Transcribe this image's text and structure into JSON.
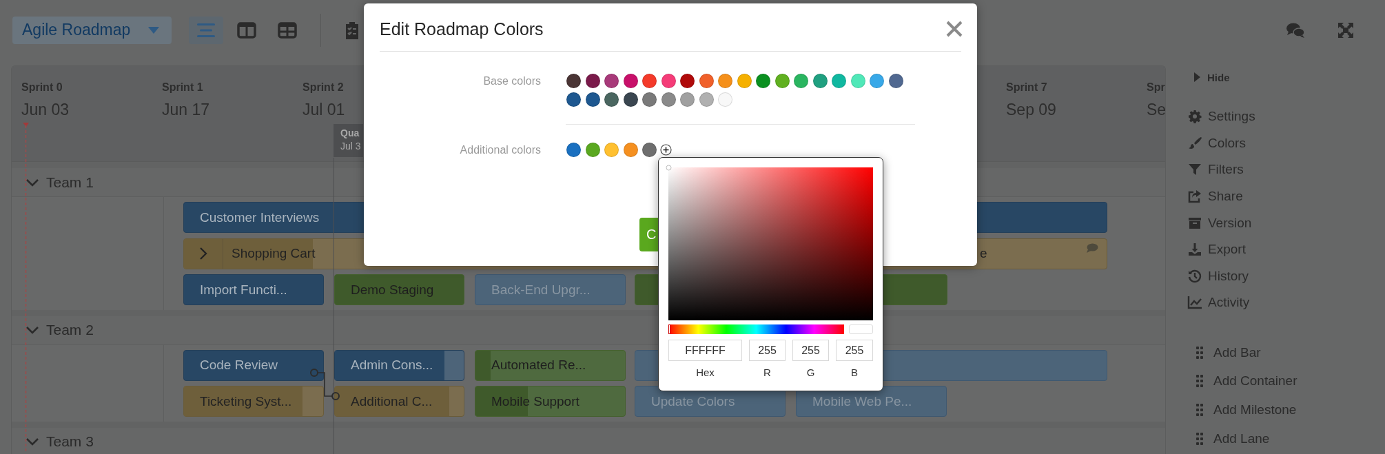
{
  "toolbar": {
    "roadmap_name": "Agile Roadmap",
    "views": [
      {
        "kind": "list",
        "selected": true
      },
      {
        "kind": "split",
        "selected": false
      },
      {
        "kind": "grid",
        "selected": false
      }
    ]
  },
  "timeline": {
    "sprints": [
      {
        "name": "Sprint 0",
        "date": "Jun 03"
      },
      {
        "name": "Sprint 1",
        "date": "Jun 17"
      },
      {
        "name": "Sprint 2",
        "date": "Jul 01"
      },
      {
        "name": "Sprint 7",
        "date": "Sep 09"
      },
      {
        "name": "Spr",
        "date": "Se"
      }
    ],
    "milestone": {
      "name": "Qua",
      "date": "Jul 3"
    },
    "teams": [
      {
        "name": "Team 1",
        "expanded": true,
        "rows": [
          [
            {
              "label": "Customer Interviews",
              "kind": "blue"
            }
          ],
          [
            {
              "label": "Shopping Cart",
              "kind": "yellow",
              "container": true,
              "expanded": false,
              "level": 0.14,
              "trailing_text": "e",
              "comment": true
            }
          ],
          [
            {
              "label": "Import Functi...",
              "kind": "blue"
            },
            {
              "label": "Demo Staging",
              "kind": "green"
            },
            {
              "label": "Back-End Upgr...",
              "kind": "pale"
            },
            {
              "kind": "green"
            }
          ]
        ]
      },
      {
        "name": "Team 2",
        "expanded": true,
        "rows": [
          [
            {
              "label": "Code Review",
              "kind": "blue"
            },
            {
              "label": "Admin Cons...",
              "kind": "blue",
              "level": 0.85
            },
            {
              "label": "Automated Re...",
              "kind": "green",
              "level": 0.1
            },
            {
              "kind": "pale"
            }
          ],
          [
            {
              "label": "Ticketing Syst...",
              "kind": "yellow",
              "level": 0.85
            },
            {
              "label": "Additional C...",
              "kind": "yellow",
              "level": 0.89
            },
            {
              "label": "Mobile Support",
              "kind": "green",
              "level": 0.35
            },
            {
              "label": "Update Colors",
              "kind": "pale"
            },
            {
              "label": "Mobile Web Pe...",
              "kind": "pale"
            }
          ]
        ]
      },
      {
        "name": "Team 3",
        "expanded": true
      }
    ]
  },
  "sidebar": {
    "hide_label": "Hide",
    "items": [
      {
        "kind": "settings",
        "label": "Settings"
      },
      {
        "kind": "colors",
        "label": "Colors"
      },
      {
        "kind": "filters",
        "label": "Filters"
      },
      {
        "kind": "share",
        "label": "Share"
      },
      {
        "kind": "version",
        "label": "Version"
      },
      {
        "kind": "export",
        "label": "Export"
      },
      {
        "kind": "history",
        "label": "History"
      },
      {
        "kind": "activity",
        "label": "Activity"
      }
    ],
    "add_items": [
      "Add Bar",
      "Add Container",
      "Add Milestone",
      "Add Lane"
    ]
  },
  "modal": {
    "title": "Edit Roadmap Colors",
    "base_colors_label": "Base colors",
    "base_colors": [
      {
        "color": "#4a3535"
      },
      {
        "color": "#7a1a4a"
      },
      {
        "color": "#a83a7a"
      },
      {
        "color": "#c8106a"
      },
      {
        "color": "#f43a2a"
      },
      {
        "color": "#f53c78"
      },
      {
        "color": "#b00a0a"
      },
      {
        "color": "#f0602a"
      },
      {
        "color": "#f5901a"
      },
      {
        "color": "#f5b000"
      },
      {
        "color": "#0a9020"
      },
      {
        "color": "#60b020"
      },
      {
        "color": "#2ab560"
      },
      {
        "color": "#20a080"
      },
      {
        "color": "#10b8a0"
      },
      {
        "color": "#50e8b8"
      },
      {
        "color": "#38a8e8"
      },
      {
        "color": "#506890"
      },
      {
        "color": "#1e5890"
      },
      {
        "color": "#1e5890"
      },
      {
        "color": "#4a6660"
      },
      {
        "color": "#3a4650"
      },
      {
        "color": "#7a7a7a"
      },
      {
        "color": "#8a8a8a"
      },
      {
        "color": "#a0a0a0"
      },
      {
        "color": "#b0b0b0"
      },
      {
        "color": "#f8f8f8"
      }
    ],
    "additional_colors_label": "Additional colors",
    "additional_colors": [
      {
        "color": "#1a70c0"
      },
      {
        "color": "#5aa820"
      },
      {
        "color": "#ffc030"
      },
      {
        "color": "#f59020"
      },
      {
        "color": "#6e6e6e"
      }
    ],
    "button": "C"
  },
  "color_picker": {
    "hue": {
      "level": 0
    },
    "hex": "FFFFFF",
    "r": "255",
    "g": "255",
    "b": "255",
    "labels": [
      "Hex",
      "R",
      "G",
      "B"
    ]
  }
}
